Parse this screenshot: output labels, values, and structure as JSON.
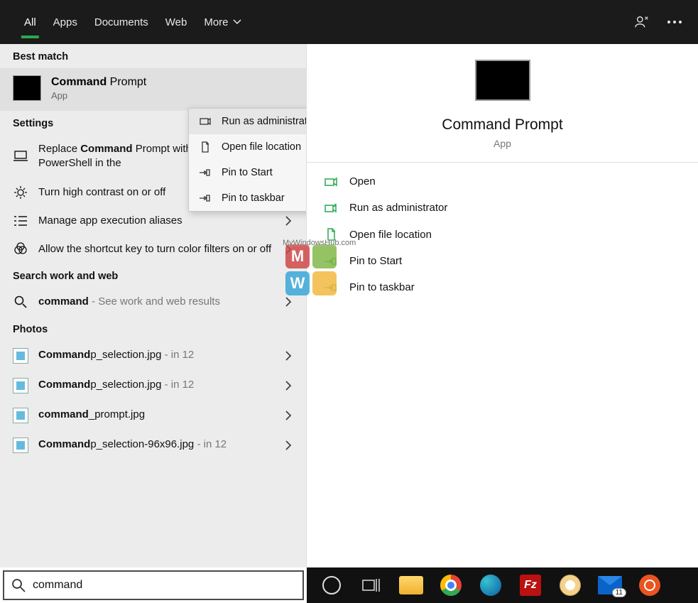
{
  "tabs": {
    "all": "All",
    "apps": "Apps",
    "documents": "Documents",
    "web": "Web",
    "more": "More"
  },
  "sections": {
    "best_match": "Best match",
    "settings": "Settings",
    "search_web": "Search work and web",
    "photos": "Photos"
  },
  "best_match": {
    "title_bold": "Command",
    "title_rest": " Prompt",
    "subtitle": "App"
  },
  "settings_items": [
    {
      "pre": "Replace ",
      "bold": "Command",
      "post": " Prompt with Windows PowerShell in the"
    },
    {
      "pre": "Turn high contrast on or off",
      "bold": "",
      "post": ""
    },
    {
      "pre": "Manage app execution aliases",
      "bold": "",
      "post": ""
    },
    {
      "pre": "Allow the shortcut key to turn color filters on or off",
      "bold": "",
      "post": ""
    }
  ],
  "search_web_item": {
    "bold": "command",
    "suffix": " - See work and web results"
  },
  "photos": [
    {
      "bold": "Command",
      "rest": "p_selection.jpg",
      "meta": " - in 12"
    },
    {
      "bold": "Command",
      "rest": "p_selection.jpg",
      "meta": " - in 12"
    },
    {
      "bold": "command",
      "rest": "_prompt.jpg",
      "meta": ""
    },
    {
      "bold": "Command",
      "rest": "p_selection-96x96.jpg",
      "meta": " - in 12"
    }
  ],
  "context_menu": {
    "run_admin": "Run as administrator",
    "open_loc": "Open file location",
    "pin_start": "Pin to Start",
    "pin_taskbar": "Pin to taskbar"
  },
  "preview": {
    "title": "Command Prompt",
    "subtitle": "App"
  },
  "preview_actions": {
    "open": "Open",
    "run_admin": "Run as administrator",
    "open_loc": "Open file location",
    "pin_start": "Pin to Start",
    "pin_taskbar": "Pin to taskbar"
  },
  "search": {
    "value": "command"
  },
  "mail_badge": "11",
  "filezilla": "Fz",
  "watermark": "MyWindowsHub.com"
}
